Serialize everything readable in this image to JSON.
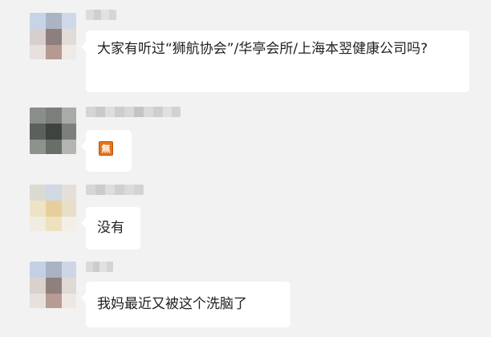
{
  "chat": {
    "messages": [
      {
        "sender_pixelated": true,
        "content_type": "text",
        "text": "大家有听过“狮航协会”/华亭会所/上海本翌健康公司吗?"
      },
      {
        "sender_pixelated": true,
        "content_type": "emoji",
        "emoji": "無"
      },
      {
        "sender_pixelated": true,
        "content_type": "text",
        "text": "没有"
      },
      {
        "sender_pixelated": true,
        "content_type": "text",
        "text": "我妈最近又被这个洗脑了"
      }
    ]
  },
  "colors": {
    "background": "#f2f2f2",
    "bubble": "#ffffff",
    "text": "#1f1f1f",
    "emoji_badge": "#e3751c"
  }
}
